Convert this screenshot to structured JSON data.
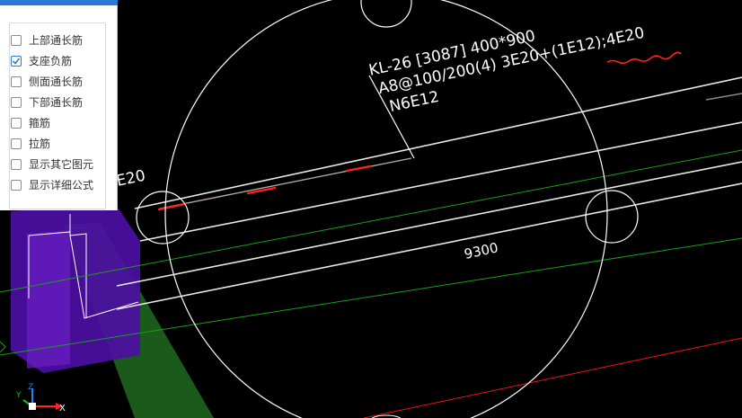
{
  "panel": {
    "checkboxes": [
      {
        "label": "上部通长筋",
        "checked": false
      },
      {
        "label": "支座负筋",
        "checked": true
      },
      {
        "label": "侧面通长筋",
        "checked": false
      },
      {
        "label": "下部通长筋",
        "checked": false
      },
      {
        "label": "箍筋",
        "checked": false
      },
      {
        "label": "拉筋",
        "checked": false
      },
      {
        "label": "显示其它图元",
        "checked": false
      },
      {
        "label": "显示详细公式",
        "checked": false
      }
    ]
  },
  "beam_annotation": {
    "line1": "KL-26 [3087] 400*900",
    "line2": "A8@100/200(4) 3E20+(1E12);4E20",
    "line3": "N6E12"
  },
  "span_dimension": "9300",
  "left_partial_label": "E20",
  "axes": {
    "x_label": "X",
    "y_label": "Y",
    "z_label": "Z"
  },
  "colors": {
    "accent": "#2b78d6",
    "beam_lines": "#ffffff",
    "rebar_highlight": "#ff2020",
    "grid_green": "#1fa01f",
    "column_purple": "#5a10b8"
  }
}
